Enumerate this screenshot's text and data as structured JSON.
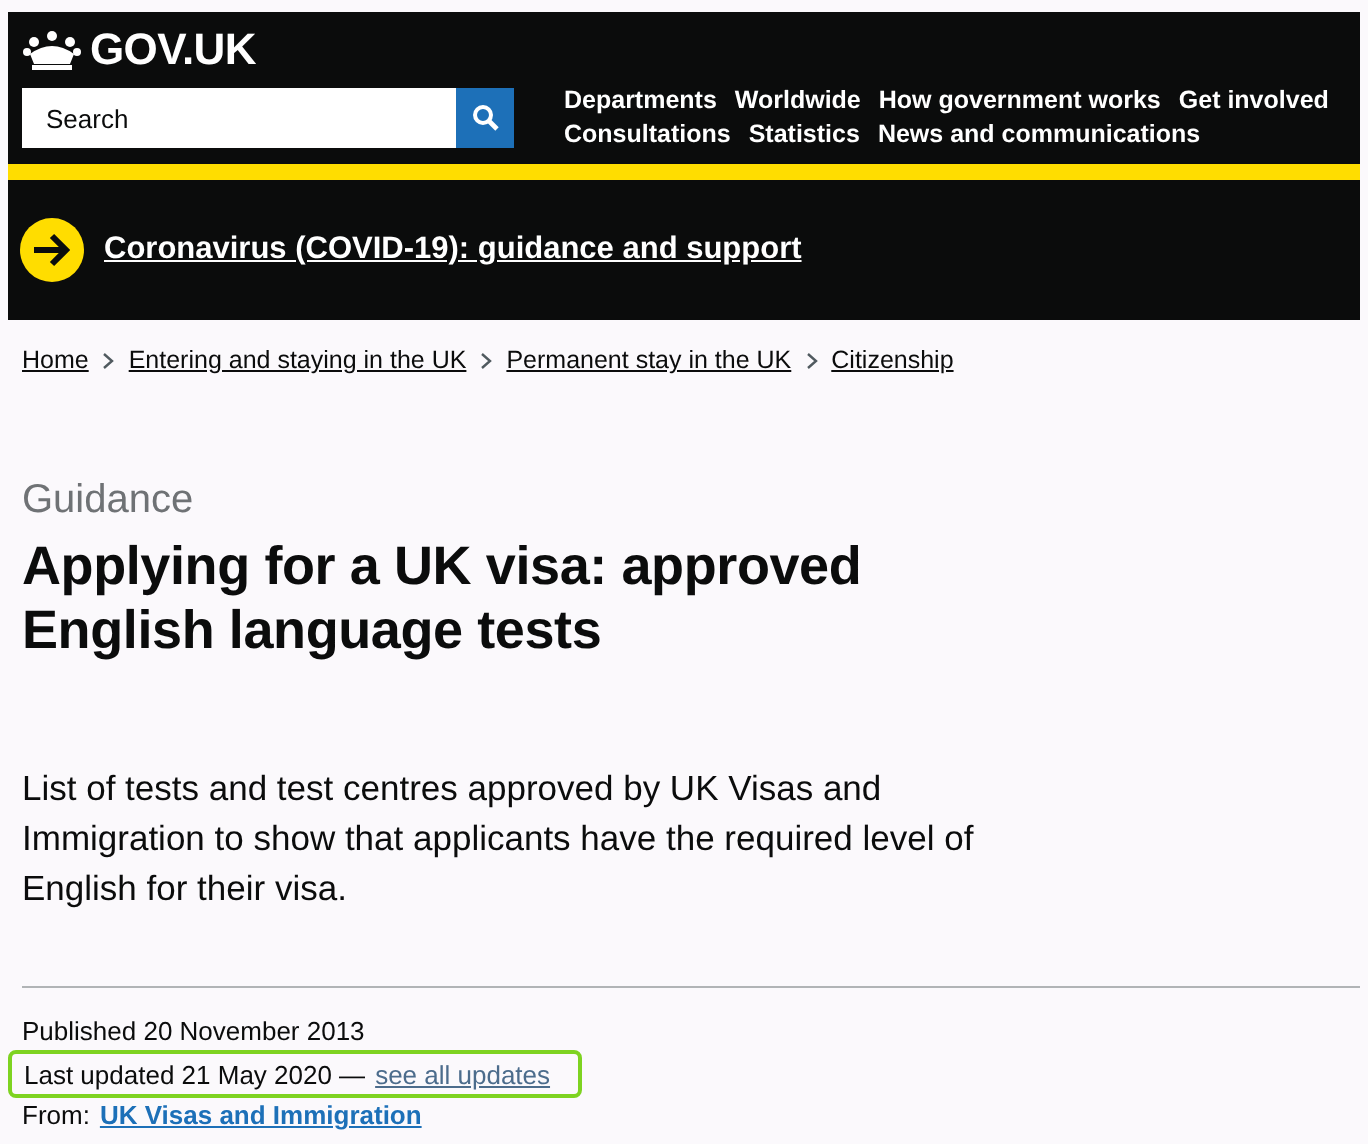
{
  "header": {
    "logo": "GOV.UK",
    "search": {
      "placeholder": "Search"
    },
    "nav_rows": [
      [
        "Departments",
        "Worldwide",
        "How government works",
        "Get involved"
      ],
      [
        "Consultations",
        "Statistics",
        "News and communications"
      ]
    ]
  },
  "banner": {
    "link": "Coronavirus (COVID-19): guidance and support"
  },
  "breadcrumbs": [
    "Home",
    "Entering and staying in the UK",
    "Permanent stay in the UK",
    "Citizenship"
  ],
  "page": {
    "label": "Guidance",
    "title": "Applying for a UK visa: approved English language tests",
    "description": "List of tests and test centres approved by UK Visas and Immigration to show that applicants have the required level of English for their visa."
  },
  "metadata": {
    "published": "Published 20 November 2013",
    "last_updated": {
      "text": "Last updated 21 May 2020 —",
      "link": "see all updates",
      "highlighted": true
    },
    "from": {
      "label": "From:",
      "link": "UK Visas and Immigration"
    }
  }
}
